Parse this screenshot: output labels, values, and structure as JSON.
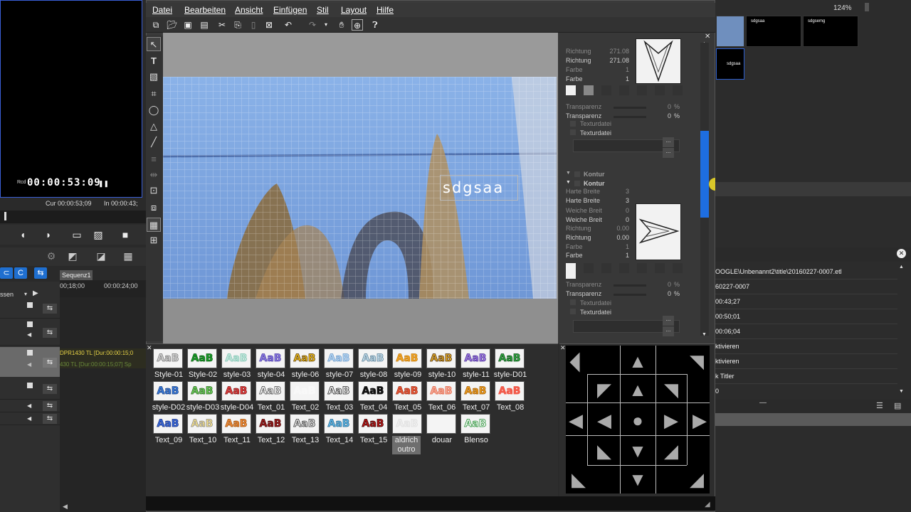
{
  "left": {
    "timecode": "00:00:53:09",
    "rec_label": "Rcd",
    "cur_label": "Cur 00:00:53;09",
    "in_label": "In 00:00:43;",
    "sequence_tab": "Sequenz1",
    "ruler_t1": "00;18;00",
    "ruler_t2": "00:00:24;00",
    "track_label": "ssen",
    "clip_text_1": "DPR1430  TL [Dur:00:00:15;0",
    "clip_text_2": "430  TL [Dur:00:00:15;07]  Sp"
  },
  "menu": [
    "Datei",
    "Bearbeiten",
    "Ansicht",
    "Einfügen",
    "Stil",
    "Layout",
    "Hilfe"
  ],
  "canvas": {
    "text": "sdgsaa"
  },
  "props": {
    "rows_top": [
      {
        "label": "Richtung",
        "value": "271.08",
        "dim": true
      },
      {
        "label": "Richtung",
        "value": "271.08",
        "dim": false
      },
      {
        "label": "Farbe",
        "value": "1",
        "dim": true
      },
      {
        "label": "Farbe",
        "value": "1",
        "dim": false
      }
    ],
    "transp_top": [
      {
        "label": "Transparenz",
        "value": "0",
        "unit": "%",
        "dim": true
      },
      {
        "label": "Transparenz",
        "value": "0",
        "unit": "%",
        "dim": false
      }
    ],
    "texture_top": [
      "Texturdatei",
      "Texturdatei"
    ],
    "section_kontur": [
      "Kontur",
      "Kontur"
    ],
    "rows_kontur": [
      {
        "label": "Harte Breite",
        "value": "3",
        "dim": true
      },
      {
        "label": "Harte Breite",
        "value": "3",
        "dim": false
      },
      {
        "label": "Weiche Breit",
        "value": "0",
        "dim": true
      },
      {
        "label": "Weiche Breit",
        "value": "0",
        "dim": false
      },
      {
        "label": "Richtung",
        "value": "0.00",
        "dim": true
      },
      {
        "label": "Richtung",
        "value": "0.00",
        "dim": false
      },
      {
        "label": "Farbe",
        "value": "1",
        "dim": true
      },
      {
        "label": "Farbe",
        "value": "1",
        "dim": false
      }
    ],
    "transp_bottom": [
      {
        "label": "Transparenz",
        "value": "0",
        "unit": "%",
        "dim": true
      },
      {
        "label": "Transparenz",
        "value": "0",
        "unit": "%",
        "dim": false
      }
    ],
    "texture_bottom": [
      "Texturdatei",
      "Texturdatei"
    ],
    "browse": "..."
  },
  "gallery": {
    "sample_text": "AaB",
    "items": [
      {
        "label": "Style-01",
        "color": "#d8d8d8",
        "stroke": "#777"
      },
      {
        "label": "Style-02",
        "color": "#1aa32a",
        "stroke": "#0b5a12"
      },
      {
        "label": "style-03",
        "color": "#c6e9df",
        "stroke": "#7ec3b1"
      },
      {
        "label": "style-04",
        "color": "#8c7be0",
        "stroke": "#4d3fa8"
      },
      {
        "label": "style-06",
        "color": "#f0c020",
        "stroke": "#5a3a00"
      },
      {
        "label": "style-07",
        "color": "#b8d8f4",
        "stroke": "#6a98c8"
      },
      {
        "label": "style-08",
        "color": "#c8e0ee",
        "stroke": "#5a7f95"
      },
      {
        "label": "style-09",
        "color": "#f5a623",
        "stroke": "#c27c12"
      },
      {
        "label": "style-10",
        "color": "#e8b030",
        "stroke": "#4a2a00"
      },
      {
        "label": "style-11",
        "color": "#a07ae0",
        "stroke": "#4a2f96"
      },
      {
        "label": "style-D01",
        "color": "#33aa44",
        "stroke": "#0f4d18"
      },
      {
        "label": "style-D02",
        "color": "#3a7ee0",
        "stroke": "#1a3f80"
      },
      {
        "label": "style-D03",
        "color": "#6ccf5a",
        "stroke": "#2a6a20"
      },
      {
        "label": "style-D04",
        "color": "#e84040",
        "stroke": "#7a1010"
      },
      {
        "label": "Text_01",
        "color": "#ffffff",
        "stroke": "#444"
      },
      {
        "label": "Text_02",
        "color": "#f8f8f8",
        "stroke": "#f8f8f8"
      },
      {
        "label": "Text_03",
        "color": "#ffffff",
        "stroke": "#222"
      },
      {
        "label": "Text_04",
        "color": "#111111",
        "stroke": "#111"
      },
      {
        "label": "Text_05",
        "color": "#f05a3a",
        "stroke": "#a02a10"
      },
      {
        "label": "Text_06",
        "color": "#f7b0a0",
        "stroke": "#e06040"
      },
      {
        "label": "Text_07",
        "color": "#f0a020",
        "stroke": "#a05a00"
      },
      {
        "label": "Text_08",
        "color": "#f25a4a",
        "stroke": "#f25a4a"
      },
      {
        "label": "Text_09",
        "color": "#3a6ee0",
        "stroke": "#1a2f80"
      },
      {
        "label": "Text_10",
        "color": "#f4e08a",
        "stroke": "#888"
      },
      {
        "label": "Text_11",
        "color": "#f09040",
        "stroke": "#a04a00"
      },
      {
        "label": "Text_12",
        "color": "#a02020",
        "stroke": "#400"
      },
      {
        "label": "Text_13",
        "color": "#e8e8e8",
        "stroke": "#333"
      },
      {
        "label": "Text_14",
        "color": "#60b8e8",
        "stroke": "#2a6a90"
      },
      {
        "label": "Text_15",
        "color": "#c01818",
        "stroke": "#300"
      },
      {
        "label": "aldrich outro",
        "color": "#f0f0f0",
        "stroke": "#ddd"
      },
      {
        "label": "douar",
        "color": "#f4f4f4",
        "stroke": "#f4f4f4"
      },
      {
        "label": "Blenso",
        "color": "#ffffff",
        "stroke": "#1a8a2a"
      }
    ]
  },
  "right": {
    "zoom": "124%",
    "bin_labels": [
      "sdgsaa",
      "sdgsemg",
      "sdgsaa"
    ],
    "info_rows": [
      "OOGLE\\Unbenannt2\\title\\20160227-0007.etl",
      "60227-0007",
      "00:43;27",
      "00:50;01",
      "00:06;04",
      "ktivieren",
      "ktivieren",
      "k Titler",
      "0"
    ]
  },
  "colors": {
    "accent": "#1e6ee0",
    "canvas_sky": "#7fa6de"
  }
}
